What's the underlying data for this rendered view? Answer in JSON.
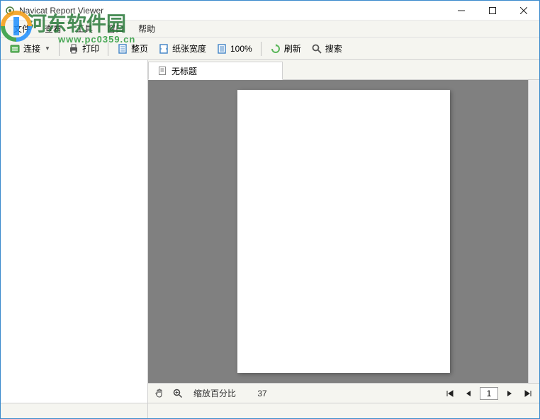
{
  "window": {
    "title": "Navicat Report Viewer"
  },
  "menubar": {
    "items": [
      "文件",
      "查看",
      "工具",
      "窗口",
      "帮助"
    ]
  },
  "toolbar": {
    "connect_label": "连接",
    "print_label": "打印",
    "whole_page_label": "整页",
    "paper_width_label": "纸张宽度",
    "zoom100_label": "100%",
    "refresh_label": "刷新",
    "search_label": "搜索"
  },
  "tab": {
    "title": "无标题"
  },
  "bottom": {
    "zoom_label": "缩放百分比",
    "zoom_value": "37",
    "page_current": "1"
  },
  "watermark": {
    "text": "河东软件园",
    "url": "www.pc0359.cn"
  }
}
